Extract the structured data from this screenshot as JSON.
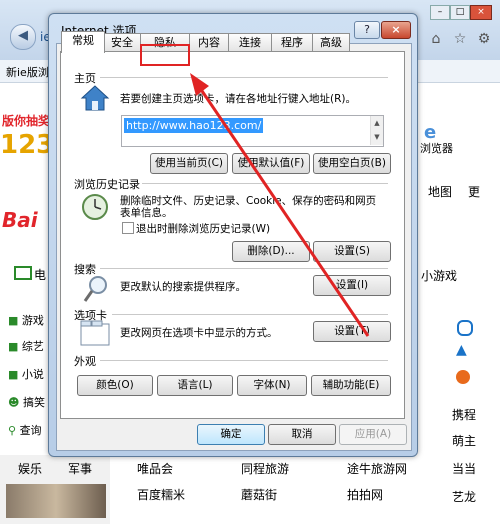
{
  "background": {
    "address_prefix": "ie",
    "tab_text": "新ie版浏",
    "ad_text": "版你抽奖",
    "logo_123": "123",
    "logo_bai": "Bai",
    "browser_label": "浏览器",
    "map_label": "地图",
    "more_label": "更",
    "left_tab": "电",
    "mini_games": "小游戏",
    "sidebar_items": [
      "游戏",
      "综艺",
      "小说",
      "搞笑",
      "查询"
    ],
    "row_labels": [
      "携程",
      "萌主",
      "当当",
      "艺龙"
    ],
    "bottom_cats": [
      "娱乐",
      "军事"
    ],
    "bottom_links": [
      "唯品会",
      "同程旅游",
      "途牛旅游网",
      "百度糯米",
      "蘑菇街",
      "拍拍网"
    ]
  },
  "dialog": {
    "title": "Internet 选项",
    "help_label": "?",
    "close_label": "×",
    "tabs": [
      "常规",
      "安全",
      "隐私",
      "内容",
      "连接",
      "程序",
      "高级"
    ],
    "active_tab": "常规",
    "highlighted_tab": "隐私",
    "homepage": {
      "heading": "主页",
      "description": "若要创建主页选项卡，请在各地址行键入地址(R)。",
      "url": "http://www.hao123.com/",
      "buttons": [
        "使用当前页(C)",
        "使用默认值(F)",
        "使用空白页(B)"
      ]
    },
    "history": {
      "heading": "浏览历史记录",
      "description_line1": "删除临时文件、历史记录、Cookie、保存的密码和网页",
      "description_line2": "表单信息。",
      "checkbox_label": "退出时删除浏览历史记录(W)",
      "delete_button": "删除(D)...",
      "settings_button": "设置(S)"
    },
    "search": {
      "heading": "搜索",
      "description": "更改默认的搜索提供程序。",
      "settings_button": "设置(I)"
    },
    "tabs_section": {
      "heading": "选项卡",
      "description": "更改网页在选项卡中显示的方式。",
      "settings_button": "设置(T)"
    },
    "appearance": {
      "heading": "外观",
      "buttons": [
        "颜色(O)",
        "语言(L)",
        "字体(N)",
        "辅助功能(E)"
      ]
    },
    "footer": {
      "ok": "确定",
      "cancel": "取消",
      "apply": "应用(A)"
    }
  },
  "colors": {
    "highlight": "#e02424",
    "selection": "#3399ff"
  }
}
